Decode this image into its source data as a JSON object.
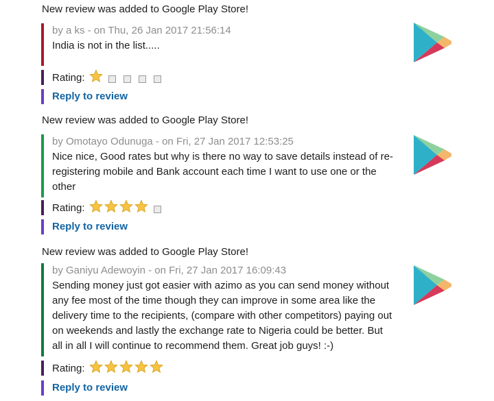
{
  "reviews": [
    {
      "intro": "New review was added to Google Play Store!",
      "author_line": "by a ks - on Thu, 26 Jan 2017 21:56:14",
      "text": "India is not in the list.....",
      "accent_color": "#a8182c",
      "stars": 1,
      "max_stars": 5,
      "rating_label": "Rating:",
      "reply_label": "Reply to review",
      "icon": "google-play-icon"
    },
    {
      "intro": "New review was added to Google Play Store!",
      "author_line": "by Omotayo Odunuga - on Fri, 27 Jan 2017 12:53:25",
      "text": "Nice nice, Good rates but why is there no way to save details instead of re-registering  mobile and Bank account each time I want to use one or the other",
      "accent_color": "#1a9a4a",
      "stars": 4,
      "max_stars": 5,
      "rating_label": "Rating:",
      "reply_label": "Reply to review",
      "icon": "google-play-icon"
    },
    {
      "intro": "New review was added to Google Play Store!",
      "author_line": "by Ganiyu Adewoyin - on Fri, 27 Jan 2017 16:09:43",
      "text": "Sending money just got easier with azimo as you can send money without any fee most of the time though they can improve in some area like the delivery time to the recipients, (compare with other competitors) paying out on weekends and lastly the exchange rate to Nigeria could be better. But all in all I will continue to recommend them. Great job guys! :-)",
      "accent_color": "#127a3f",
      "stars": 5,
      "max_stars": 5,
      "rating_label": "Rating:",
      "reply_label": "Reply to review",
      "icon": "google-play-icon"
    }
  ],
  "colors": {
    "rating_bar": "#4a1e5c",
    "reply_bar": "#6b3cc9",
    "link": "#1264a3",
    "author": "#8d8d8d",
    "star_fill": "#f6c343"
  }
}
